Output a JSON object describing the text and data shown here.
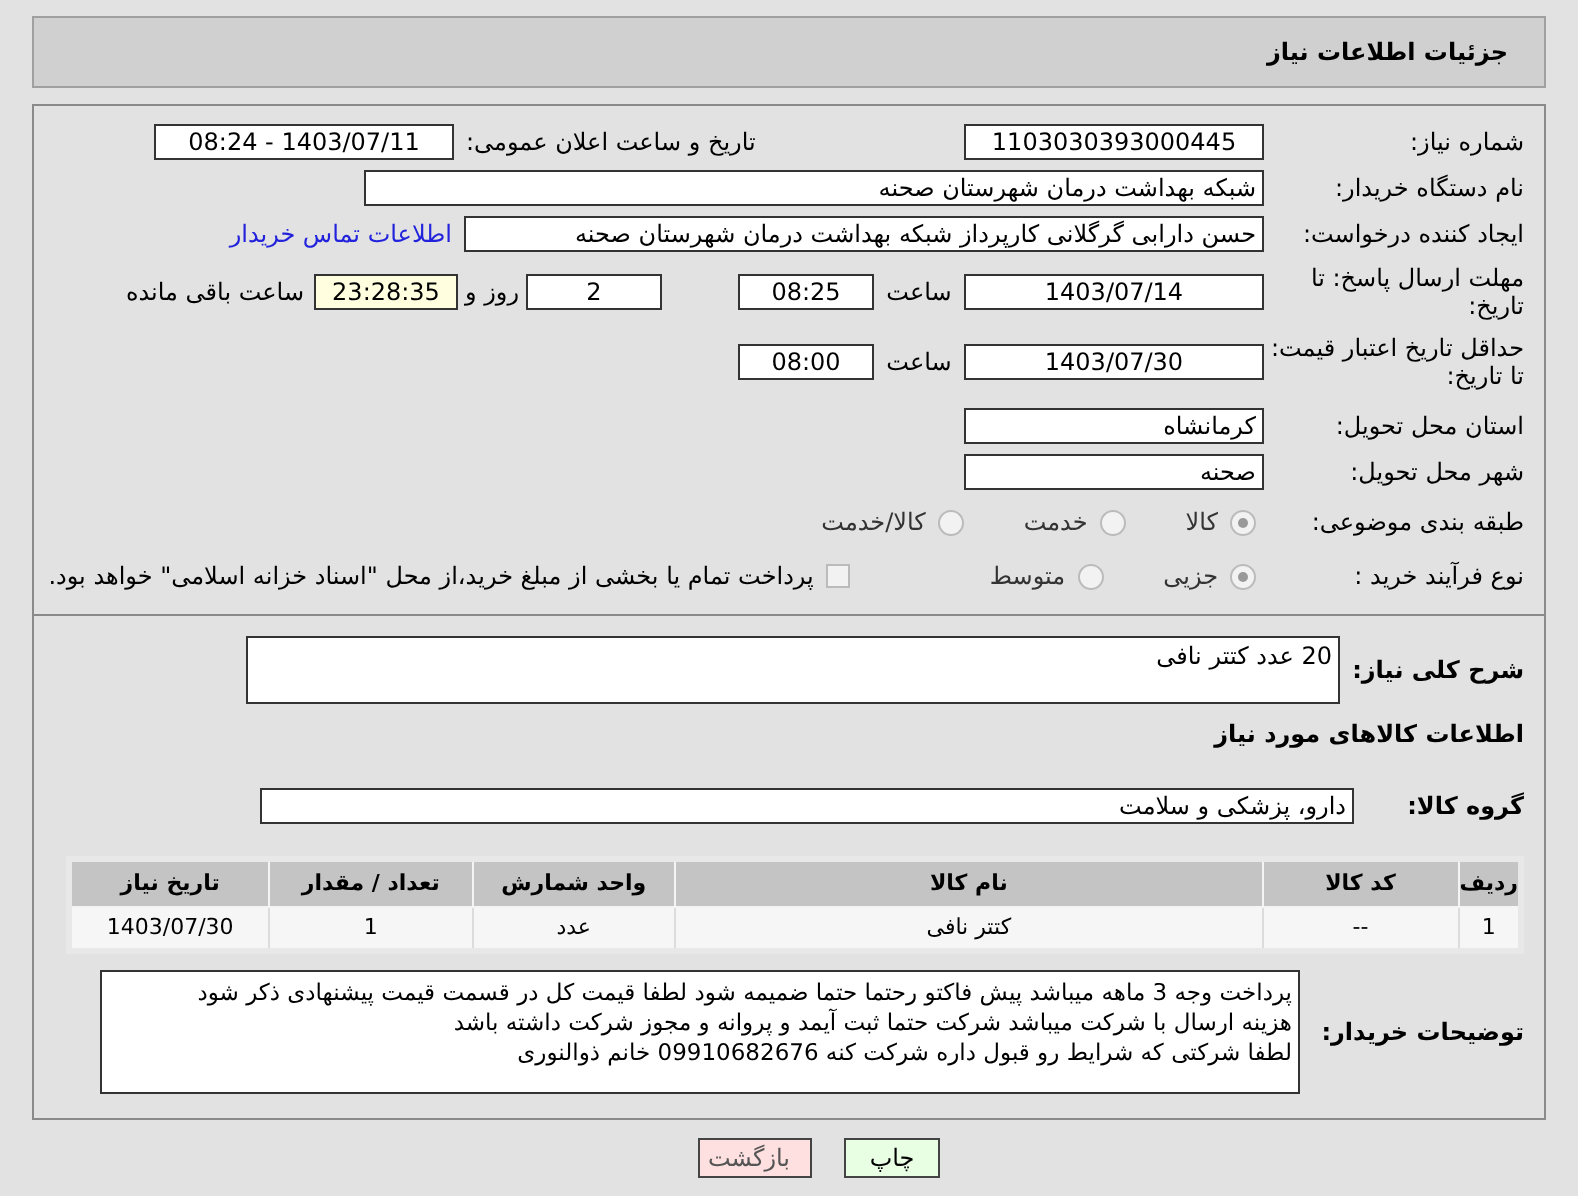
{
  "header": {
    "title": "جزئیات اطلاعات نیاز"
  },
  "need_number": {
    "label": "شماره نیاز:",
    "value": "1103030393000445"
  },
  "announce": {
    "label": "تاریخ و ساعت اعلان عمومی:",
    "value": "1403/07/11 - 08:24"
  },
  "buyer_org": {
    "label": "نام دستگاه خریدار:",
    "value": "شبکه بهداشت درمان شهرستان صحنه"
  },
  "requester": {
    "label": "ایجاد کننده درخواست:",
    "value": "حسن دارابی گرگلانی کارپرداز شبکه بهداشت درمان شهرستان صحنه",
    "link": "اطلاعات تماس خریدار"
  },
  "reply_deadline": {
    "label": "مهلت ارسال پاسخ: تا تاریخ:",
    "date": "1403/07/14",
    "time_label": "ساعت",
    "time": "08:25",
    "days": "2",
    "days_label": "روز و",
    "remaining": "23:28:35",
    "remaining_label": "ساعت باقی مانده"
  },
  "price_validity": {
    "label": "حداقل تاریخ اعتبار قیمت: تا تاریخ:",
    "date": "1403/07/30",
    "time_label": "ساعت",
    "time": "08:00"
  },
  "province": {
    "label": "استان محل تحویل:",
    "value": "کرمانشاه"
  },
  "city": {
    "label": "شهر محل تحویل:",
    "value": "صحنه"
  },
  "category": {
    "label": "طبقه بندی موضوعی:",
    "options": [
      {
        "label": "کالا",
        "selected": true
      },
      {
        "label": "خدمت",
        "selected": false
      },
      {
        "label": "کالا/خدمت",
        "selected": false
      }
    ]
  },
  "process": {
    "label": "نوع فرآیند خرید :",
    "options": [
      {
        "label": "جزیی",
        "selected": true
      },
      {
        "label": "متوسط",
        "selected": false
      }
    ],
    "treasury": {
      "label": "پرداخت تمام یا بخشی از مبلغ خرید،از محل \"اسناد خزانه اسلامی\" خواهد بود.",
      "checked": false
    }
  },
  "description": {
    "label": "شرح کلی نیاز:",
    "value": "20 عدد کتتر نافی"
  },
  "goods_heading": "اطلاعات کالاهای مورد نیاز",
  "goods_group": {
    "label": "گروه کالا:",
    "value": "دارو، پزشکی و سلامت"
  },
  "table": {
    "columns": [
      "ردیف",
      "کد کالا",
      "نام کالا",
      "واحد شمارش",
      "تعداد / مقدار",
      "تاریخ نیاز"
    ],
    "rows": [
      [
        "1",
        "--",
        "کتتر نافی",
        "عدد",
        "1",
        "1403/07/30"
      ]
    ]
  },
  "buyer_notes": {
    "label": "توضیحات خریدار:",
    "lines": [
      "پرداخت وجه 3 ماهه میباشد پیش فاکتو رحتما حتما ضمیمه شود لطفا قیمت کل در قسمت قیمت پیشنهادی ذکر شود",
      "هزینه ارسال با شرکت میباشد  شرکت حتما ثبت آیمد و پروانه و مجوز شرکت داشته باشد",
      "لطفا شرکتی که شرایط رو قبول داره شرکت کنه 09910682676  خانم ذوالنوری"
    ]
  },
  "buttons": [
    {
      "kind": "print",
      "label": "چاپ"
    },
    {
      "kind": "back",
      "label": "بازگشت"
    }
  ]
}
